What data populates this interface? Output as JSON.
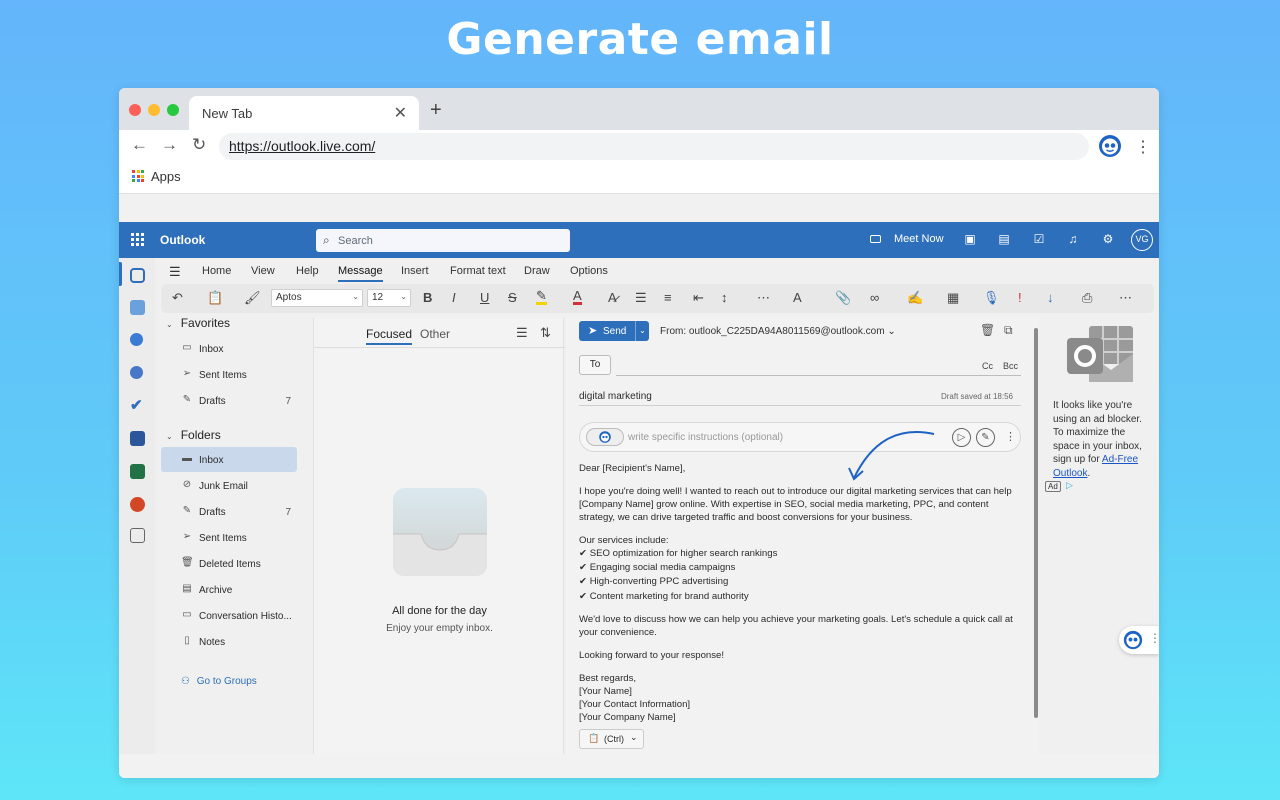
{
  "hero": {
    "title": "Generate email"
  },
  "browser": {
    "tab_title": "New Tab",
    "url": "https://outlook.live.com/",
    "bookmarks_apps": "Apps"
  },
  "outlook": {
    "brand": "Outlook",
    "search_placeholder": "Search",
    "meet_now": "Meet Now",
    "avatar_initials": "VG",
    "ribbon_tabs": [
      "Home",
      "View",
      "Help",
      "Message",
      "Insert",
      "Format text",
      "Draw",
      "Options"
    ],
    "font_name": "Aptos",
    "font_size": "12",
    "favorites": {
      "heading": "Favorites",
      "items": [
        {
          "label": "Inbox",
          "count": ""
        },
        {
          "label": "Sent Items",
          "count": ""
        },
        {
          "label": "Drafts",
          "count": "7"
        }
      ]
    },
    "folders": {
      "heading": "Folders",
      "items": [
        {
          "label": "Inbox",
          "count": ""
        },
        {
          "label": "Junk Email",
          "count": ""
        },
        {
          "label": "Drafts",
          "count": "7"
        },
        {
          "label": "Sent Items",
          "count": ""
        },
        {
          "label": "Deleted Items",
          "count": ""
        },
        {
          "label": "Archive",
          "count": ""
        },
        {
          "label": "Conversation Histo...",
          "count": ""
        },
        {
          "label": "Notes",
          "count": ""
        }
      ],
      "go_to_groups": "Go to Groups"
    },
    "message_list": {
      "tab_focused": "Focused",
      "tab_other": "Other",
      "empty_title": "All done for the day",
      "empty_subtitle": "Enjoy your empty inbox."
    },
    "compose": {
      "send_label": "Send",
      "from": "From: outlook_C225DA94A8011569@outlook.com",
      "to_label": "To",
      "cc": "Cc",
      "bcc": "Bcc",
      "subject": "digital marketing",
      "draft_saved": "Draft saved at 18:56",
      "ai_placeholder": "write specific instructions (optional)",
      "greeting": "Dear [Recipient's Name],",
      "para1": "I hope you're doing well! I wanted to reach out to introduce our digital marketing services that can help [Company Name] grow online. With expertise in SEO, social media marketing, PPC, and content strategy, we can drive targeted traffic and boost conversions for your business.",
      "services_heading": "Our services include:",
      "services": [
        "✔ SEO optimization for higher search rankings",
        "✔ Engaging social media campaigns",
        "✔ High-converting PPC advertising",
        "✔ Content marketing for brand authority"
      ],
      "para2": "We'd love to discuss how we can help you achieve your marketing goals. Let's schedule a quick call at your convenience.",
      "para3": "Looking forward to your response!",
      "signoff": [
        "Best regards,",
        "[Your Name]",
        "[Your Contact Information]",
        "[Your Company Name]"
      ],
      "paste_label": "(Ctrl)"
    },
    "ad": {
      "text_before": "It looks like you're using an ad blocker. To maximize the space in your inbox, sign up for ",
      "link": "Ad-Free Outlook",
      "text_after": ".",
      "badge": "Ad"
    }
  },
  "colors": {
    "outlook_blue": "#2e6fbc",
    "background_top": "#64b5fb",
    "background_bottom": "#5ee6f8",
    "selected_folder": "#c9d8ea",
    "arrow": "#1e63c4"
  }
}
